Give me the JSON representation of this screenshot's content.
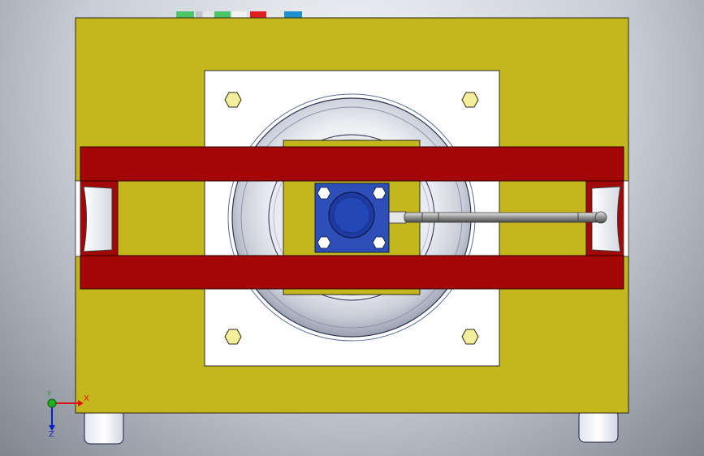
{
  "viewport": {
    "axes": {
      "x_label": "X",
      "y_label": "Y",
      "z_label": "Z"
    }
  },
  "colors": {
    "base_plate": "#c4b71e",
    "mount_plate": "#ffffff",
    "clamp_bar": "#a30707",
    "center_block": "#2e4fb8",
    "center_boss": "#1f3ba3",
    "rod": "#8d8d8d",
    "hex_nut": "#f4ef9c",
    "axis_x": "#e01010",
    "axis_y": "#10a010",
    "axis_z": "#1020c0"
  },
  "model_icons": [
    "base-plate-icon",
    "mounting-plate-icon",
    "spherical-bearing-icon",
    "clamp-bar-icon",
    "center-block-icon",
    "push-rod-icon",
    "hex-nut-icon",
    "support-foot-icon",
    "axis-triad-icon"
  ]
}
